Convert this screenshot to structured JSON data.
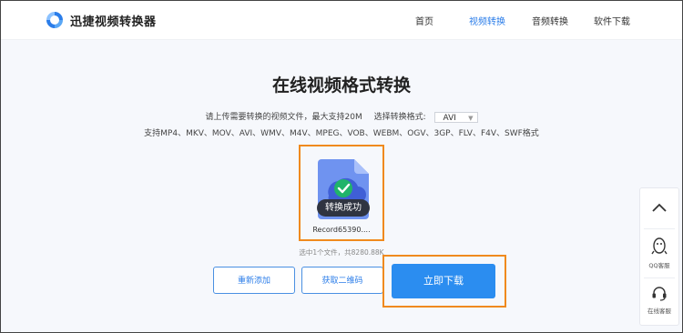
{
  "header": {
    "brand": "迅捷视频转换器",
    "nav": [
      {
        "label": "首页"
      },
      {
        "label": "视频转换"
      },
      {
        "label": "音频转换"
      },
      {
        "label": "软件下载"
      }
    ]
  },
  "main": {
    "title": "在线视频格式转换",
    "upload_hint": "请上传需要转换的视频文件，最大支持20M",
    "format_select_label": "选择转换格式:",
    "format_selected": "AVI",
    "supported_formats": "支持MP4、MKV、MOV、AVI、WMV、M4V、MPEG、VOB、WEBM、OGV、3GP、FLV、F4V、SWF格式",
    "file": {
      "status": "转换成功",
      "name": "Record65390...."
    },
    "selected_info": "选中1个文件，共8280.88K",
    "buttons": {
      "re_add": "重新添加",
      "qr_code": "获取二维码",
      "download": "立即下载"
    }
  },
  "side_panel": {
    "qq": "QQ客服",
    "online": "在线客服"
  },
  "colors": {
    "accent": "#2b8df0",
    "highlight": "#f08a1e",
    "success": "#20b46a"
  }
}
